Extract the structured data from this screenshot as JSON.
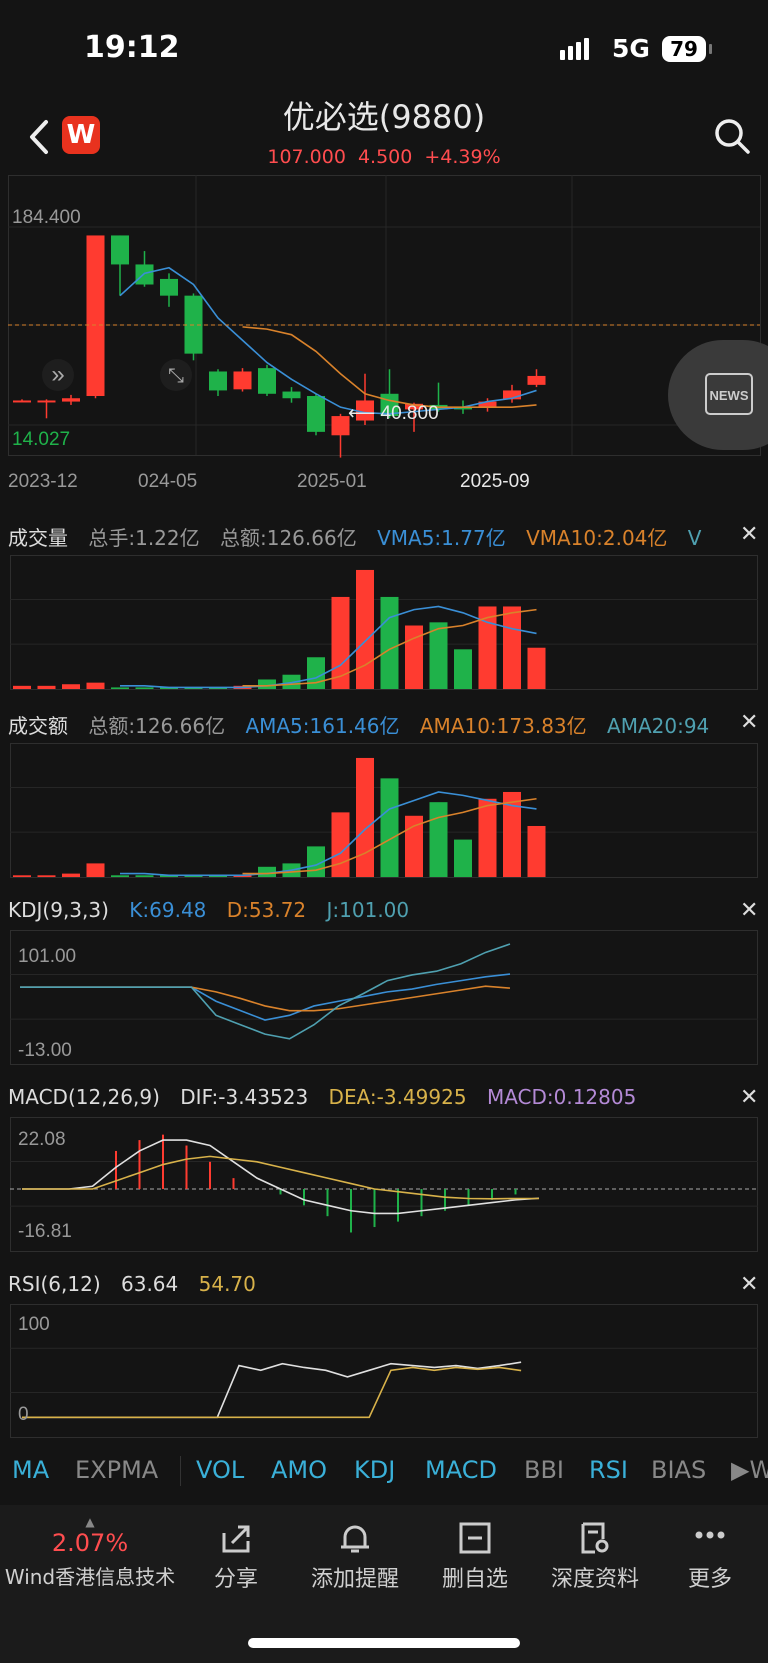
{
  "status": {
    "time": "19:12",
    "network": "5G",
    "battery": "79"
  },
  "header": {
    "title": "优必选(9880)",
    "price": "107.000",
    "change": "4.500",
    "pct": "+4.39%",
    "logo": "W"
  },
  "colors": {
    "up": "#ff3b30",
    "down": "#1fb24a",
    "ma5": "#3a8fd6",
    "ma10": "#d9822b",
    "white": "#e0e0e0",
    "yellow": "#d8b24a",
    "teal": "#4fa0b0"
  },
  "price_chart": {
    "y_max_label": "184.400",
    "y_min_label": "14.027",
    "low_marker": "40.800",
    "x_labels": [
      "2023-12",
      "024-05",
      "2025-01",
      "2025-09"
    ],
    "news_label": "NEWS"
  },
  "volume": {
    "name": "成交量",
    "total_hands": "总手:1.22亿",
    "total_amount": "总额:126.66亿",
    "vma5": "VMA5:1.77亿",
    "vma10": "VMA10:2.04亿",
    "more": "V"
  },
  "amount": {
    "name": "成交额",
    "total_amount": "总额:126.66亿",
    "ama5": "AMA5:161.46亿",
    "ama10": "AMA10:173.83亿",
    "ama20": "AMA20:94"
  },
  "kdj": {
    "name": "KDJ(9,3,3)",
    "k": "K:69.48",
    "d": "D:53.72",
    "j": "J:101.00",
    "top_label": "101.00",
    "bottom_label": "-13.00"
  },
  "macd": {
    "name": "MACD(12,26,9)",
    "dif": "DIF:-3.43523",
    "dea": "DEA:-3.49925",
    "macd": "MACD:0.12805",
    "top_label": "22.08",
    "bottom_label": "-16.81"
  },
  "rsi": {
    "name": "RSI(6,12)",
    "rsi6": "63.64",
    "rsi12": "54.70",
    "top_label": "100",
    "bottom_label": "0"
  },
  "tabs": [
    "MA",
    "EXPMA",
    "VOL",
    "AMO",
    "KDJ",
    "MACD",
    "BBI",
    "RSI",
    "BIAS",
    "W"
  ],
  "bottom_nav": {
    "stock_pct": "2.07%",
    "stock_name": "Wind香港信息技术",
    "share": "分享",
    "alert": "添加提醒",
    "remove": "删自选",
    "deep": "深度资料",
    "more": "更多"
  },
  "chart_data": [
    {
      "type": "candlestick",
      "title": "优必选(9880)",
      "ylim": [
        14.027,
        184.4
      ],
      "candles": [
        {
          "o": 36,
          "c": 36,
          "h": 37,
          "l": 35,
          "up": true
        },
        {
          "o": 35,
          "c": 36,
          "h": 37,
          "l": 20,
          "up": true
        },
        {
          "o": 35,
          "c": 38,
          "h": 41,
          "l": 32,
          "up": true
        },
        {
          "o": 40,
          "c": 184,
          "h": 184,
          "l": 38,
          "up": true
        },
        {
          "o": 184,
          "c": 158,
          "h": 184,
          "l": 130,
          "up": false
        },
        {
          "o": 158,
          "c": 140,
          "h": 170,
          "l": 138,
          "up": false
        },
        {
          "o": 145,
          "c": 130,
          "h": 150,
          "l": 120,
          "up": false
        },
        {
          "o": 130,
          "c": 78,
          "h": 132,
          "l": 72,
          "up": false
        },
        {
          "o": 62,
          "c": 45,
          "h": 64,
          "l": 40,
          "up": false
        },
        {
          "o": 46,
          "c": 62,
          "h": 65,
          "l": 44,
          "up": true
        },
        {
          "o": 65,
          "c": 42,
          "h": 68,
          "l": 40,
          "up": false
        },
        {
          "o": 44,
          "c": 38,
          "h": 48,
          "l": 34,
          "up": false
        },
        {
          "o": 40,
          "c": 10,
          "h": 42,
          "l": 8,
          "up": false
        },
        {
          "o": 8,
          "c": 22,
          "h": 24,
          "l": -5,
          "up": true
        },
        {
          "o": 18,
          "c": 36,
          "h": 60,
          "l": 14,
          "up": true
        },
        {
          "o": 42,
          "c": 22,
          "h": 64,
          "l": 20,
          "up": false
        },
        {
          "o": 28,
          "c": 33,
          "h": 34,
          "l": 10,
          "up": true
        },
        {
          "o": 32,
          "c": 28,
          "h": 52,
          "l": 26,
          "up": false
        },
        {
          "o": 30,
          "c": 28,
          "h": 36,
          "l": 24,
          "up": false
        },
        {
          "o": 30,
          "c": 35,
          "h": 38,
          "l": 26,
          "up": true
        },
        {
          "o": 37,
          "c": 45,
          "h": 50,
          "l": 34,
          "up": true
        },
        {
          "o": 50,
          "c": 58,
          "h": 64,
          "l": 48,
          "up": true
        }
      ],
      "ma5": [
        null,
        null,
        null,
        null,
        130,
        150,
        155,
        140,
        110,
        90,
        70,
        55,
        42,
        30,
        25,
        24,
        26,
        28,
        30,
        35,
        38,
        45
      ],
      "ma10": [
        null,
        null,
        null,
        null,
        null,
        null,
        null,
        null,
        null,
        102,
        100,
        95,
        80,
        60,
        42,
        36,
        32,
        30,
        30,
        30,
        30,
        32
      ]
    },
    {
      "type": "bar",
      "title": "成交量",
      "values": [
        2,
        2,
        3,
        4,
        1,
        1,
        1,
        1,
        1,
        2,
        6,
        9,
        20,
        58,
        75,
        58,
        40,
        42,
        25,
        52,
        52,
        26
      ],
      "vma5": [
        null,
        null,
        null,
        null,
        2,
        2,
        1,
        1,
        1,
        1,
        2,
        4,
        7,
        15,
        30,
        45,
        50,
        52,
        48,
        42,
        38,
        35
      ],
      "vma10": [
        null,
        null,
        null,
        null,
        null,
        null,
        null,
        null,
        null,
        2,
        2,
        3,
        4,
        8,
        15,
        25,
        32,
        38,
        40,
        45,
        48,
        50
      ]
    },
    {
      "type": "bar",
      "title": "成交额",
      "values": [
        1,
        1,
        2,
        8,
        1,
        1,
        1,
        1,
        1,
        1,
        6,
        8,
        18,
        38,
        70,
        58,
        36,
        44,
        22,
        46,
        50,
        30
      ],
      "ama5": [
        null,
        null,
        null,
        null,
        2,
        2,
        1,
        1,
        1,
        1,
        2,
        4,
        7,
        14,
        28,
        40,
        45,
        50,
        48,
        45,
        42,
        40
      ],
      "ama10": [
        null,
        null,
        null,
        null,
        null,
        null,
        null,
        null,
        null,
        2,
        2,
        3,
        4,
        8,
        14,
        22,
        30,
        35,
        38,
        42,
        44,
        46
      ]
    },
    {
      "type": "line",
      "title": "KDJ(9,3,3)",
      "ylim": [
        -13,
        101
      ],
      "k": [
        55,
        55,
        55,
        55,
        55,
        55,
        55,
        55,
        40,
        30,
        20,
        25,
        35,
        40,
        45,
        50,
        53,
        58,
        62,
        66,
        69
      ],
      "d": [
        55,
        55,
        55,
        55,
        55,
        55,
        55,
        55,
        50,
        43,
        35,
        30,
        30,
        32,
        36,
        40,
        44,
        48,
        52,
        56,
        54
      ],
      "j": [
        55,
        55,
        55,
        55,
        55,
        55,
        55,
        55,
        25,
        15,
        5,
        0,
        15,
        35,
        48,
        62,
        68,
        72,
        80,
        92,
        101
      ]
    },
    {
      "type": "bar",
      "title": "MACD(12,26,9)",
      "ylim": [
        -16.81,
        22.08
      ],
      "hist": [
        0,
        0,
        0,
        0,
        14,
        18,
        20,
        16,
        10,
        4,
        0,
        -2,
        -6,
        -10,
        -16,
        -14,
        -12,
        -10,
        -8,
        -6,
        -4,
        -2,
        0
      ],
      "dif": [
        0,
        0,
        0,
        1,
        8,
        14,
        18,
        18,
        16,
        10,
        4,
        0,
        -4,
        -6,
        -8,
        -9,
        -9,
        -8,
        -7,
        -6,
        -5,
        -4,
        -3.4
      ],
      "dea": [
        0,
        0,
        0,
        0,
        3,
        6,
        9,
        11,
        12,
        11,
        10,
        8,
        6,
        4,
        2,
        0,
        -1,
        -2,
        -3,
        -3.5,
        -3.6,
        -3.5,
        -3.5
      ]
    },
    {
      "type": "line",
      "title": "RSI(6,12)",
      "ylim": [
        0,
        100
      ],
      "rsi6": [
        5,
        5,
        5,
        5,
        5,
        5,
        5,
        5,
        5,
        5,
        60,
        55,
        62,
        58,
        55,
        48,
        55,
        62,
        60,
        58,
        60,
        57,
        60,
        63.6
      ],
      "rsi12": [
        5,
        5,
        5,
        5,
        5,
        5,
        5,
        5,
        5,
        5,
        5,
        5,
        5,
        5,
        5,
        5,
        5,
        55,
        58,
        55,
        58,
        56,
        58,
        54.7
      ]
    }
  ]
}
